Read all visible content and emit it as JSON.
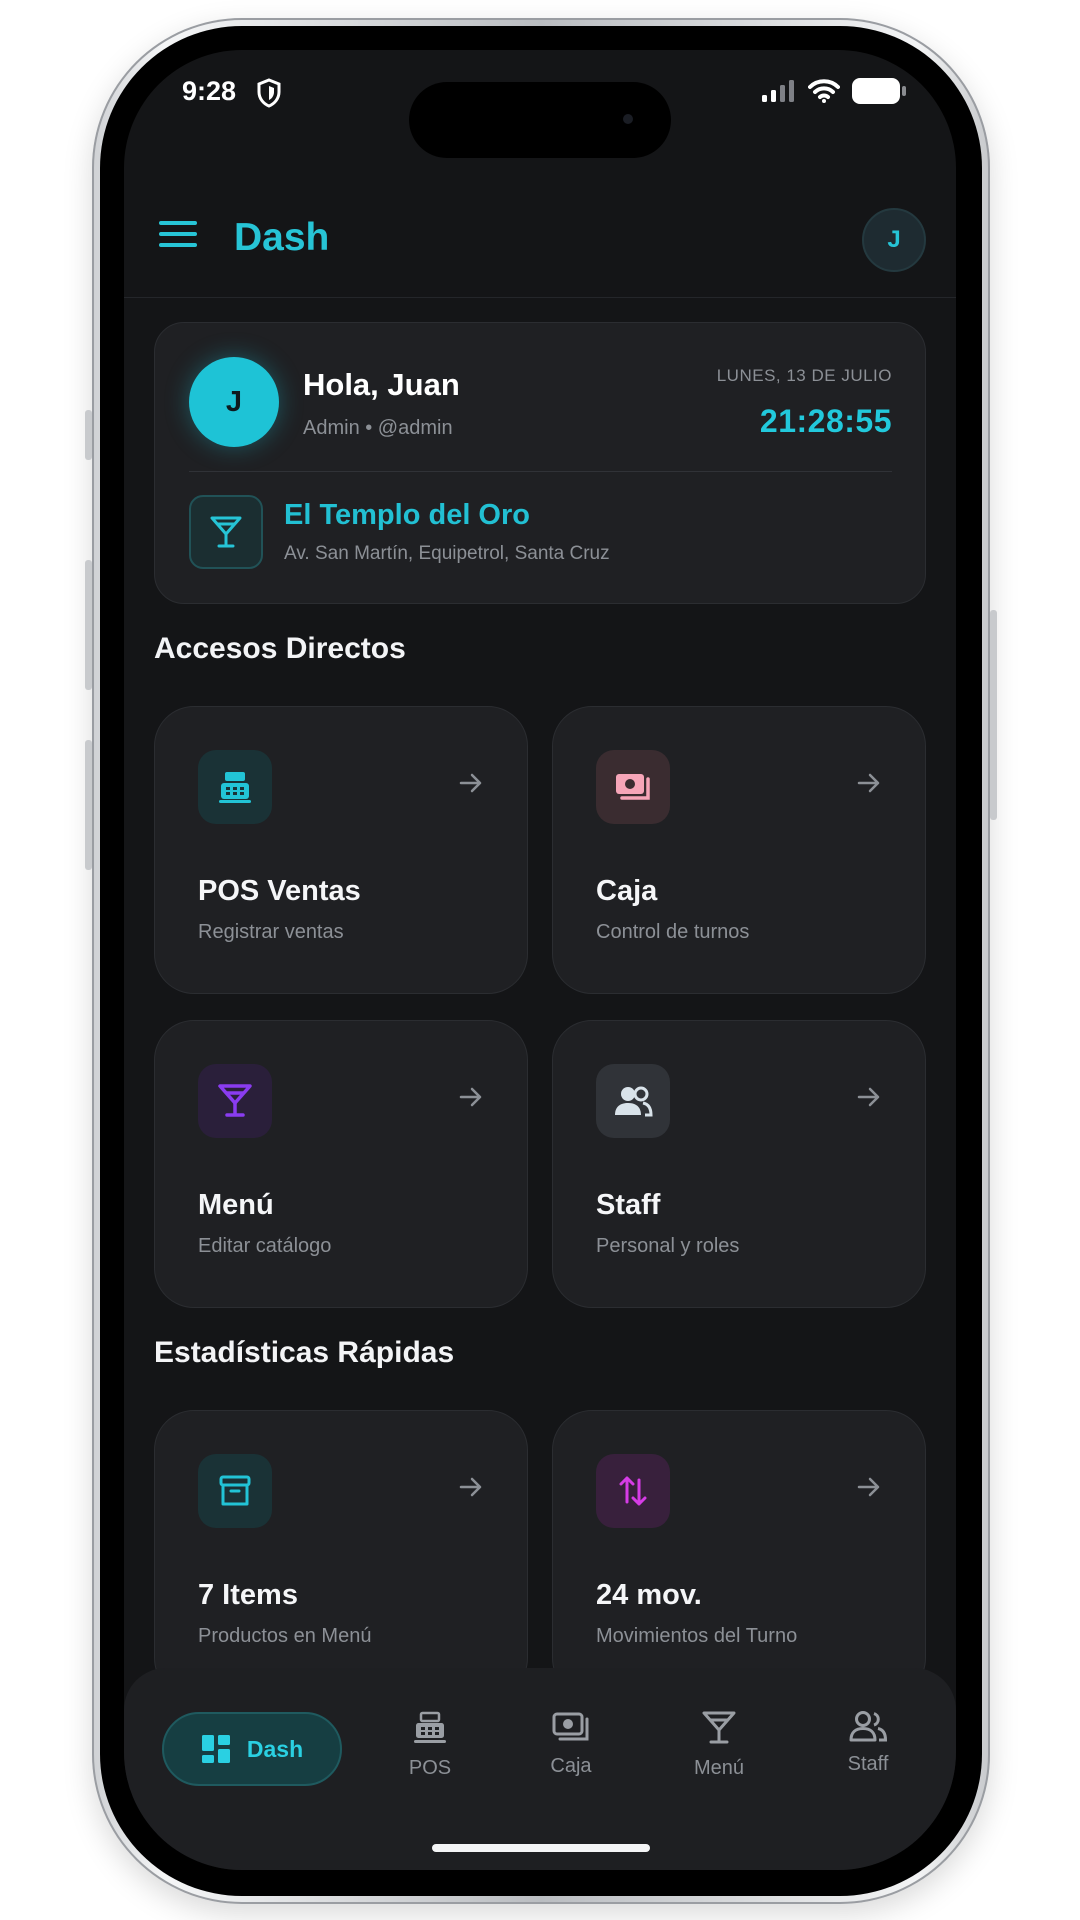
{
  "status_bar": {
    "time": "9:28"
  },
  "header": {
    "title": "Dash",
    "avatar_initial": "J"
  },
  "profile": {
    "avatar_initial": "J",
    "greeting": "Hola, Juan",
    "role": "Admin • @admin",
    "date": "LUNES, 13 DE JULIO",
    "time": "21:28:55",
    "venue_name": "El Templo del Oro",
    "venue_address": "Av. San Martín, Equipetrol, Santa Cruz"
  },
  "shortcuts": {
    "title": "Accesos Directos",
    "items": [
      {
        "title": "POS Ventas",
        "subtitle": "Registrar ventas",
        "icon": "cash-register-icon",
        "color": "#22c4d6"
      },
      {
        "title": "Caja",
        "subtitle": "Control de turnos",
        "icon": "money-icon",
        "color": "#f6a5b8"
      },
      {
        "title": "Menú",
        "subtitle": "Editar catálogo",
        "icon": "cocktail-icon",
        "color": "#8a3cf0"
      },
      {
        "title": "Staff",
        "subtitle": "Personal y roles",
        "icon": "people-icon",
        "color": "#d9e3ea"
      }
    ]
  },
  "stats": {
    "title": "Estadísticas Rápidas",
    "items": [
      {
        "title": "7 Items",
        "subtitle": "Productos en Menú",
        "icon": "archive-icon",
        "color": "#22c4d6"
      },
      {
        "title": "24 mov.",
        "subtitle": "Movimientos del Turno",
        "icon": "swap-vertical-icon",
        "color": "#d63ce6"
      }
    ]
  },
  "bottom_nav": {
    "active": "Dash",
    "items": [
      {
        "label": "POS",
        "icon": "cash-register-icon"
      },
      {
        "label": "Caja",
        "icon": "money-icon"
      },
      {
        "label": "Menú",
        "icon": "cocktail-icon"
      },
      {
        "label": "Staff",
        "icon": "people-icon"
      }
    ]
  },
  "colors": {
    "accent": "#22c4d6",
    "background": "#141517",
    "card": "#1f2023"
  }
}
